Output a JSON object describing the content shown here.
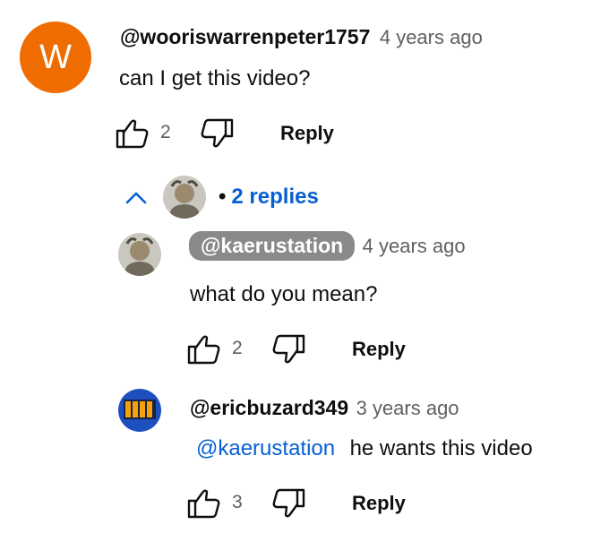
{
  "comment": {
    "avatar_letter": "W",
    "avatar_color": "#ef6c00",
    "author": "@wooriswarrenpeter1757",
    "time": "4 years ago",
    "text": "can I get this video?",
    "likes": "2",
    "reply_label": "Reply"
  },
  "replies_toggle": {
    "bullet": "•",
    "label": "2 replies",
    "icon": "chevron-up-icon"
  },
  "replies": [
    {
      "author": "@kaerustation",
      "time": "4 years ago",
      "text": "what do you mean?",
      "likes": "2",
      "reply_label": "Reply"
    },
    {
      "author": "@ericbuzard349",
      "time": "3 years ago",
      "mention": "@kaerustation",
      "text": "he wants this video",
      "likes": "3",
      "reply_label": "Reply"
    }
  ],
  "colors": {
    "link": "#065fd4",
    "secondary_text": "#606060",
    "chip_bg": "#8a8a8a"
  }
}
